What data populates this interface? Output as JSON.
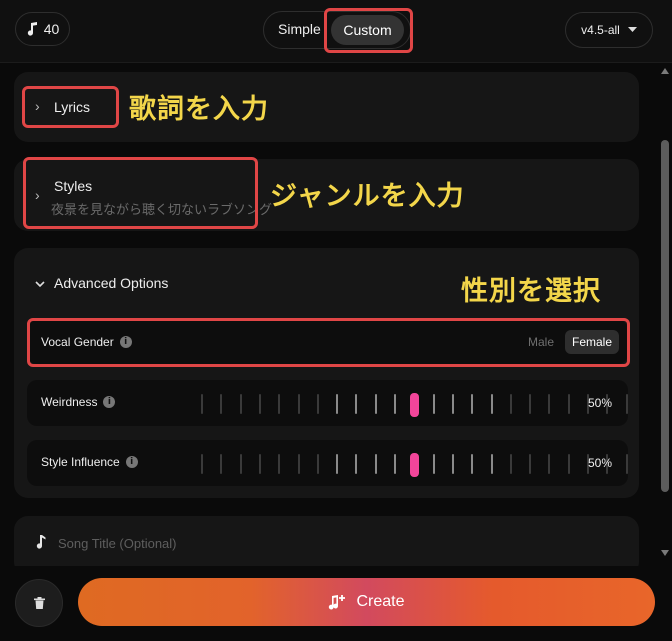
{
  "header": {
    "credits": "40",
    "mode_simple": "Simple",
    "mode_custom": "Custom",
    "version": "v4.5-all"
  },
  "lyrics": {
    "label": "Lyrics"
  },
  "styles": {
    "label": "Styles",
    "value": "夜景を見ながら聴く切ないラブソング"
  },
  "advanced": {
    "label": "Advanced Options",
    "vocal_gender": {
      "label": "Vocal Gender",
      "options": [
        "Male",
        "Female"
      ],
      "selected": "Female"
    },
    "weirdness": {
      "label": "Weirdness",
      "value": "50%"
    },
    "style_influence": {
      "label": "Style Influence",
      "value": "50%"
    }
  },
  "song_title": {
    "placeholder": "Song Title (Optional)"
  },
  "actions": {
    "create_label": "Create"
  },
  "annotations": {
    "lyrics": "歌詞を入力",
    "styles": "ジャンルを入力",
    "gender": "性別を選択"
  },
  "colors": {
    "accent_pink": "#f2459a",
    "annotation_red": "#e04646",
    "annotation_yellow": "#f3d64a"
  }
}
